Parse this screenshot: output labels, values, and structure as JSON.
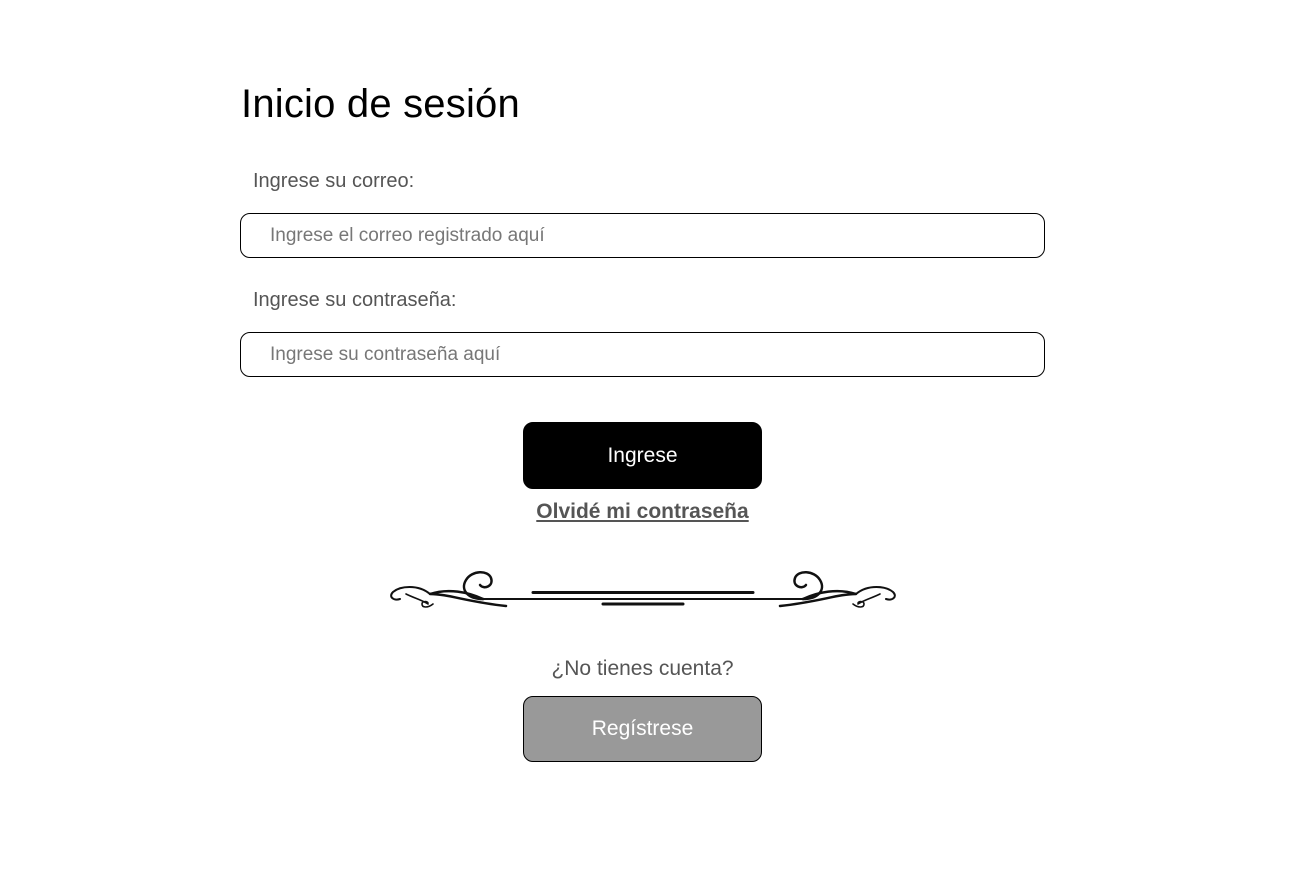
{
  "page": {
    "title": "Inicio de sesión"
  },
  "login_form": {
    "email_label": "Ingrese su correo:",
    "email_placeholder": "Ingrese el correo registrado aquí",
    "email_value": "",
    "password_label": "Ingrese su contraseña:",
    "password_placeholder": "Ingrese su contraseña aquí",
    "password_value": "",
    "submit_label": "Ingrese",
    "forgot_password_link": "Olvidé mi contraseña"
  },
  "divider": {
    "icon": "ornamental-divider-icon"
  },
  "register": {
    "prompt": "¿No tienes cuenta?",
    "button_label": "Regístrese"
  },
  "colors": {
    "login_button": "#000000",
    "register_button": "#999999",
    "label_text": "#555555"
  }
}
